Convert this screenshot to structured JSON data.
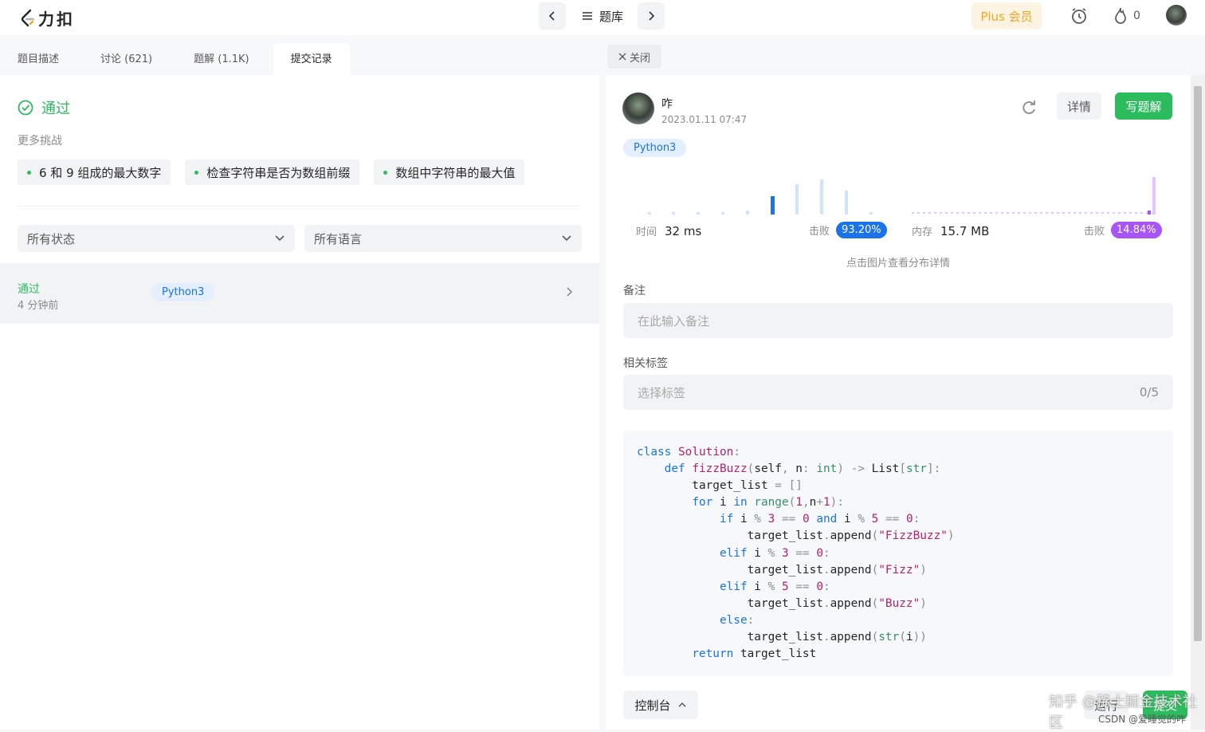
{
  "app": {
    "logo_text": "力扣"
  },
  "topnav": {
    "tiku_label": "题库",
    "plus_label": "Plus 会员",
    "fire_count": "0"
  },
  "tabs": [
    {
      "label": "题目描述"
    },
    {
      "label": "讨论 (621)"
    },
    {
      "label": "题解 (1.1K)"
    },
    {
      "label": "提交记录"
    }
  ],
  "result": {
    "status": "通过",
    "more_label": "更多挑战"
  },
  "challenges": [
    {
      "label": "6 和 9 组成的最大数字"
    },
    {
      "label": "检查字符串是否为数组前缀"
    },
    {
      "label": "数组中字符串的最大值"
    }
  ],
  "filters": {
    "status": "所有状态",
    "language": "所有语言"
  },
  "submission": {
    "status": "通过",
    "time": "4 分钟前",
    "language": "Python3"
  },
  "detail": {
    "close_label": "关闭",
    "user": "咋",
    "date": "2023.01.11 07:47",
    "detail_label": "详情",
    "write_label": "写题解",
    "language": "Python3",
    "time_label": "时间",
    "time_value": "32 ms",
    "time_beat_label": "击败",
    "time_beat": "93.20%",
    "mem_label": "内存",
    "mem_value": "15.7 MB",
    "mem_beat_label": "击败",
    "mem_beat": "14.84%",
    "hint": "点击图片查看分布详情",
    "note_label": "备注",
    "note_placeholder": "在此输入备注",
    "tags_label": "相关标签",
    "tags_placeholder": "选择标签",
    "tags_count": "0/5",
    "console_label": "控制台",
    "run_label": "运行",
    "submit_label": "提交"
  },
  "code_lines": [
    "class Solution:",
    "    def fizzBuzz(self, n: int) -> List[str]:",
    "        target_list = []",
    "        for i in range(1,n+1):",
    "            if i % 3 == 0 and i % 5 == 0:",
    "                target_list.append(\"FizzBuzz\")",
    "            elif i % 3 == 0:",
    "                target_list.append(\"Fizz\")",
    "            elif i % 5 == 0:",
    "                target_list.append(\"Buzz\")",
    "            else:",
    "                target_list.append(str(i))",
    "        return target_list"
  ],
  "watermark": {
    "text": "知乎 @稀土掘金技术社区",
    "csdn": "CSDN @爱睡觉的咋"
  },
  "colors": {
    "green": "#2cbb5d",
    "blue": "#1a73e8",
    "purple": "#a855f7"
  }
}
